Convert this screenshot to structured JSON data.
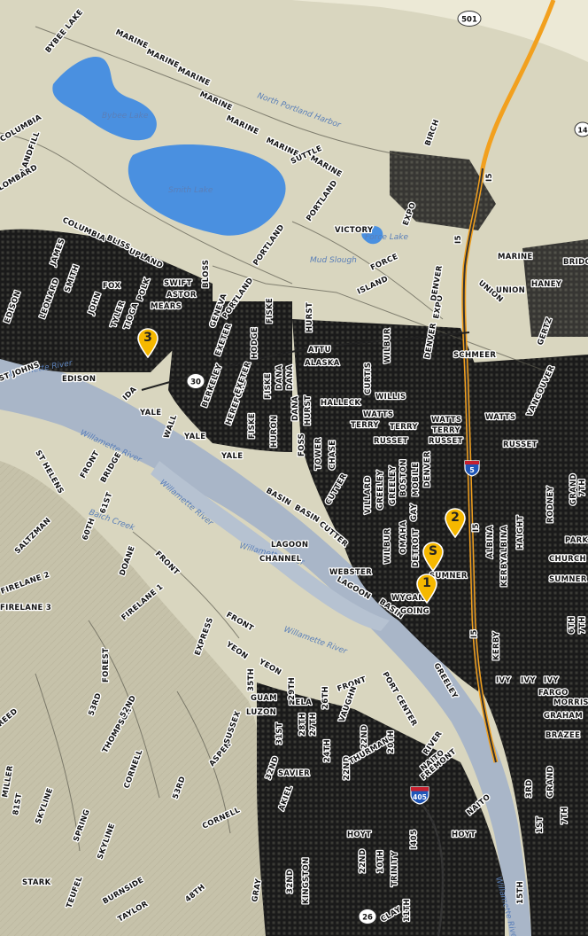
{
  "map": {
    "colors": {
      "land": "#d9d6bf",
      "hills": "#c9c5ae",
      "water": "#4a90e0",
      "river": "#aab7c9",
      "urban": "#1a1a1a",
      "freeway": "#f2a01e",
      "marker": "#f5b800",
      "highway_shield": "#ffffff",
      "interstate_shield": "#1f56b8"
    },
    "water_labels": {
      "bybee_lake": "Bybee Lake",
      "smith_lake": "Smith Lake",
      "north_portland_harbor": "North Portland Harbor",
      "mud_slough": "Mud Slough",
      "force_lake": "Force Lake",
      "willamette_river_1": "Willamette River",
      "willamette_river_2": "Willamette River",
      "willamette_river_3": "Willamette River",
      "willamette_river_4": "Willamette River",
      "willamette_river_5": "Willamette River",
      "willamette_river_6": "Willamette River",
      "balch_creek": "Balch Creek"
    },
    "street_labels": {
      "bybee_lake_rd": "BYBEE LAKE",
      "marine_1": "MARINE",
      "marine_2": "MARINE",
      "marine_3": "MARINE",
      "marine_4": "MARINE",
      "marine_5": "MARINE",
      "marine_6": "MARINE",
      "columbia_1": "COLUMBIA",
      "landfill": "LANDFILL",
      "lombard": "LOMBARD",
      "columbia_2": "COLUMBIA",
      "bliss": "BLISS",
      "upland": "UPLAND",
      "james": "JAMES",
      "smith": "SMITH",
      "leonard": "LEONARD",
      "john": "JOHN",
      "fox": "FOX",
      "tyler": "TYLER",
      "tioga": "TIOGA",
      "polk": "POLK",
      "swift": "SWIFT",
      "astor": "ASTOR",
      "bloss": "BLOSS",
      "mears": "MEARS",
      "edison_1": "EDISON",
      "edison_2": "EDISON",
      "st_johns": "ST JOHNS",
      "ida": "IDA",
      "yale_1": "YALE",
      "yale_2": "YALE",
      "yale_3": "YALE",
      "wall": "WALL",
      "berkeley": "BERKELEY",
      "hereford": "HEREFORD",
      "exeter_1": "EXETER",
      "exeter_2": "EXETER",
      "hodge": "HODGE",
      "geneva": "GENEVA",
      "fiske_1": "FISKE",
      "fiske_2": "FISKE",
      "fiske_3": "FISKE",
      "huron": "HURON",
      "portland_1": "PORTLAND",
      "portland_2": "PORTLAND",
      "portland_3": "PORTLAND",
      "suttle": "SUTTLE",
      "marine_7": "MARINE",
      "hurst_1": "HURST",
      "hurst_2": "HURST",
      "attu": "ATTU",
      "alaska": "ALASKA",
      "dana_1": "DANA",
      "dana_2": "DANA",
      "dana_3": "DANA",
      "curtis": "CURTIS",
      "wilbur_1": "WILBUR",
      "willis": "WILLIS",
      "halleck": "HALLECK",
      "watts_1": "WATTS",
      "watts_2": "WATTS",
      "watts_3": "WATTS",
      "terry_1": "TERRY",
      "terry_2": "TERRY",
      "terry_3": "TERRY",
      "russet_1": "RUSSET",
      "russet_2": "RUSSET",
      "russet_3": "RUSSET",
      "victory": "VICTORY",
      "force": "FORCE",
      "island": "ISLAND",
      "expo_1": "EXPO",
      "expo_2": "EXPO",
      "denver_1": "DENVER",
      "denver_2": "DENVER",
      "schmeer": "SCHMEER",
      "union_1": "UNION",
      "union_2": "UNION",
      "haney": "HANEY",
      "marine_8": "MARINE",
      "birch": "BIRCH",
      "bridge": "BRIDGE",
      "gertz": "GERTZ",
      "vancouver": "VANCOUVER",
      "i5_1": "I5",
      "i5_2": "I5",
      "i5_3": "I5",
      "i5_4": "I5",
      "foss": "FOSS",
      "tower": "TOWER",
      "chase": "CHASE",
      "villard": "VILLARD",
      "greeley_1": "GREELEY",
      "greeley_2": "GREELEY",
      "greeley_3": "GREELEY",
      "wilbur_2": "WILBUR",
      "omaha": "OMAHA",
      "boston": "BOSTON",
      "mobile": "MOBILE",
      "detroit": "DETROIT",
      "gay": "GAY",
      "denver_3": "DENVER",
      "cutter_1": "CUTTER",
      "cutter_2": "CUTTER",
      "basin_1": "BASIN",
      "basin_2": "BASIN",
      "basin_3": "BASIN",
      "lagoon_1": "LAGOON",
      "lagoon_2": "LAGOON",
      "channel": "CHANNEL",
      "webster": "WEBSTER",
      "wygant": "WYGANT",
      "going": "GOING",
      "sumner_1": "SUMNER",
      "sumner_2": "SUMNER",
      "albina_1": "ALBINA",
      "albina_2": "ALBINA",
      "kerby_1": "KERBY",
      "kerby_2": "KERBY",
      "haight": "HAIGHT",
      "rodney": "RODNEY",
      "grand": "GRAND",
      "seventh_1": "7TH",
      "park": "PARK",
      "church": "CHURCH",
      "sixth": "6TH",
      "seventh_2": "7TH",
      "ivy_1": "IVY",
      "ivy_2": "IVY",
      "ivy_3": "IVY",
      "fargo": "FARGO",
      "morris": "MORRIS",
      "graham": "GRAHAM",
      "brazee": "BRAZEE",
      "sixty_first": "61ST",
      "sixtieth": "60TH",
      "saltzman": "SALTZMAN",
      "st_helens": "ST HELENS",
      "front_1": "FRONT",
      "front_2": "FRONT",
      "front_3": "FRONT",
      "front_4": "FRONT",
      "doane": "DOANE",
      "bridge_2": "BRIDGE",
      "firelane_1": "FIRELANE 1",
      "firelane_2": "FIRELANE 2",
      "firelane_3": "FIRELANE 3",
      "express": "EXPRESS",
      "yeon_1": "YEON",
      "yeon_2": "YEON",
      "forest": "FOREST",
      "fifty_third_1": "53RD",
      "fifty_third_2": "53RD",
      "thompson": "THOMPSON",
      "fifty_second": "52ND",
      "cornell_1": "CORNELL",
      "cornell_2": "CORNELL",
      "aspen": "ASPEN",
      "sussex": "SUSSEX",
      "thirty_fifth": "35TH",
      "guam": "GUAM",
      "luzon": "LUZON",
      "nela": "NELA",
      "twenty_ninth": "29TH",
      "twenty_eighth": "28TH",
      "twenty_seventh": "27TH",
      "twenty_sixth": "26TH",
      "thirty_first": "31ST",
      "twenty_second_1": "22ND",
      "twenty_second_2": "22ND",
      "twentieth": "20TH",
      "twenty_fourth": "24TH",
      "vaughn": "VAUGHN",
      "thurman": "THURMAN",
      "savier": "SAVIER",
      "port_center": "PORT CENTER",
      "river": "RIVER",
      "naito_1": "NAITO",
      "naito_2": "NAITO",
      "fremont": "FREMONT",
      "thirty_second": "32ND",
      "thirty_second_2": "32ND",
      "miller": "MILLER",
      "eighty_first": "81ST",
      "skyline_1": "SKYLINE",
      "skyline_2": "SKYLINE",
      "peed": "REED",
      "spring": "SPRING",
      "burnside": "BURNSIDE",
      "stark": "STARK",
      "teufel": "TEUFEL",
      "taylor": "TAYLOR",
      "forty_eighth": "48TH",
      "gray": "GRAY",
      "kingston": "KINGSTON",
      "hoyt_1": "HOYT",
      "hoyt_2": "HOYT",
      "twenty_second_3": "22ND",
      "tenth": "10TH",
      "trinity": "TRINITY",
      "clay": "CLAY",
      "eleventh": "11TH",
      "i405": "I405",
      "third": "3RD",
      "first": "1ST",
      "akiel": "AKIEL",
      "grand_2": "GRAND",
      "mlk": "7TH",
      "fifteenth": "15TH"
    },
    "shields": {
      "us_501": "501",
      "or_30": "30",
      "i_5": "5",
      "i_405": "405",
      "i_14": "14",
      "or_26": "26"
    },
    "markers": [
      {
        "label": "3"
      },
      {
        "label": "2"
      },
      {
        "label": "S"
      },
      {
        "label": "1"
      }
    ]
  }
}
